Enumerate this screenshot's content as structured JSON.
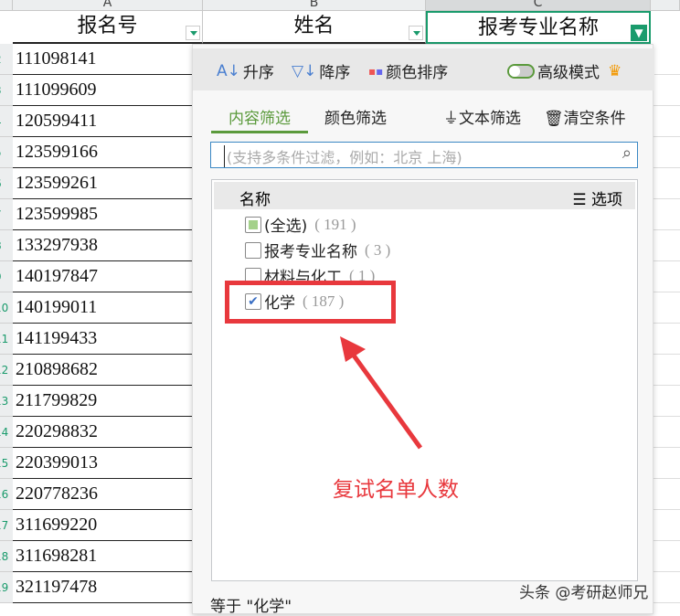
{
  "columns": [
    "A",
    "B",
    "C"
  ],
  "headers": [
    "报名号",
    "姓名",
    "报考专业名称"
  ],
  "rows": [
    "111098141",
    "111099609",
    "120599411",
    "123599166",
    "123599261",
    "123599985",
    "133297938",
    "140197847",
    "140199011",
    "141199433",
    "210898682",
    "211799829",
    "220298832",
    "220399013",
    "220778236",
    "311699220",
    "311698281",
    "321197478"
  ],
  "filter": {
    "sort_asc": "升序",
    "sort_desc": "降序",
    "sort_color": "颜色排序",
    "advanced": "高级模式",
    "tab_content": "内容筛选",
    "tab_color": "颜色筛选",
    "text_filter": "文本筛选",
    "clear": "清空条件",
    "search_placeholder": "(支持多条件过滤，例如：北京 上海)",
    "list_header": "名称",
    "options": "选项",
    "items": [
      {
        "label": "(全选)",
        "count": "( 191 )"
      },
      {
        "label": "报考专业名称",
        "count": "( 3 )"
      },
      {
        "label": "材料与化工",
        "count": "( 1 )"
      },
      {
        "label": "化学",
        "count": "( 187 )"
      }
    ],
    "footer": "等于 \"化学\""
  },
  "annotation": {
    "text": "复试名单人数",
    "color": "#e8383d"
  },
  "watermark": "头条 @考研赵师兄",
  "colors": {
    "accent": "#1a9b6c",
    "tab": "#5b9a3c"
  }
}
